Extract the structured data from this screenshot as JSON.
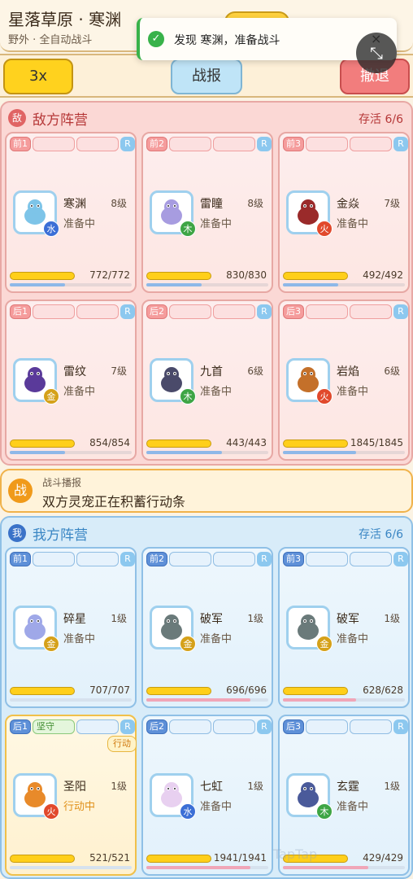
{
  "header": {
    "title": "星落草原 · 寒渊",
    "subtitle": "野外 · 全自动战斗"
  },
  "toast": {
    "icon": "check-icon",
    "text": "发现 寒渊，准备战斗",
    "close": "×"
  },
  "controls": {
    "speed_label": "3x",
    "report_label": "战报",
    "retreat_label": "撤退",
    "collapse_icon": "⤡"
  },
  "enemy": {
    "badge": "敌",
    "title": "敌方阵营",
    "alive": "存活 6/6",
    "pets": [
      {
        "slot": "前1",
        "name": "寒渊",
        "level": "8级",
        "status": "准备中",
        "element": "水",
        "hp": "772/772",
        "hp_ratio": 1.0,
        "energy_ratio": 0.45,
        "color": "#7dc4e8"
      },
      {
        "slot": "前2",
        "name": "雷瞳",
        "level": "8级",
        "status": "准备中",
        "element": "木",
        "hp": "830/830",
        "hp_ratio": 1.0,
        "energy_ratio": 0.45,
        "color": "#a79ce0"
      },
      {
        "slot": "前3",
        "name": "金焱",
        "level": "7级",
        "status": "准备中",
        "element": "火",
        "hp": "492/492",
        "hp_ratio": 1.0,
        "energy_ratio": 0.45,
        "color": "#9a2a2a"
      },
      {
        "slot": "后1",
        "name": "雷纹",
        "level": "7级",
        "status": "准备中",
        "element": "金",
        "hp": "854/854",
        "hp_ratio": 1.0,
        "energy_ratio": 0.45,
        "color": "#5a3a9a"
      },
      {
        "slot": "后2",
        "name": "九首",
        "level": "6级",
        "status": "准备中",
        "element": "木",
        "hp": "443/443",
        "hp_ratio": 1.0,
        "energy_ratio": 0.62,
        "color": "#4a4a6a"
      },
      {
        "slot": "后3",
        "name": "岩焰",
        "level": "6级",
        "status": "准备中",
        "element": "火",
        "hp": "1845/1845",
        "hp_ratio": 1.0,
        "energy_ratio": 0.6,
        "color": "#c4702a"
      }
    ]
  },
  "battle_report": {
    "badge": "战",
    "label": "战斗播报",
    "text": "双方灵宠正在积蓄行动条"
  },
  "ally": {
    "badge": "我",
    "title": "我方阵营",
    "alive": "存活 6/6",
    "pets": [
      {
        "slot": "前1",
        "name": "碎星",
        "level": "1级",
        "status": "准备中",
        "element": "金",
        "hp": "707/707",
        "hp_ratio": 1.0,
        "energy_ratio": 0.0,
        "color": "#9fa8e8",
        "tag": ""
      },
      {
        "slot": "前2",
        "name": "破军",
        "level": "1级",
        "status": "准备中",
        "element": "金",
        "hp": "696/696",
        "hp_ratio": 1.0,
        "energy_ratio": 0.85,
        "color": "#6a7a7a",
        "tag": ""
      },
      {
        "slot": "前3",
        "name": "破军",
        "level": "1级",
        "status": "准备中",
        "element": "金",
        "hp": "628/628",
        "hp_ratio": 1.0,
        "energy_ratio": 0.6,
        "color": "#6a7a7a",
        "tag": ""
      },
      {
        "slot": "后1",
        "name": "圣阳",
        "level": "1级",
        "status": "行动中",
        "element": "火",
        "hp": "521/521",
        "hp_ratio": 1.0,
        "energy_ratio": 0.0,
        "color": "#e88a2a",
        "tag": "坚守",
        "action": "行动"
      },
      {
        "slot": "后2",
        "name": "七虹",
        "level": "1级",
        "status": "准备中",
        "element": "水",
        "hp": "1941/1941",
        "hp_ratio": 1.0,
        "energy_ratio": 0.85,
        "color": "#e8d0f0",
        "tag": ""
      },
      {
        "slot": "后3",
        "name": "玄霆",
        "level": "1级",
        "status": "准备中",
        "element": "木",
        "hp": "429/429",
        "hp_ratio": 1.0,
        "energy_ratio": 0.7,
        "color": "#4a5a9a",
        "tag": ""
      }
    ]
  },
  "watermark": "TapTap"
}
